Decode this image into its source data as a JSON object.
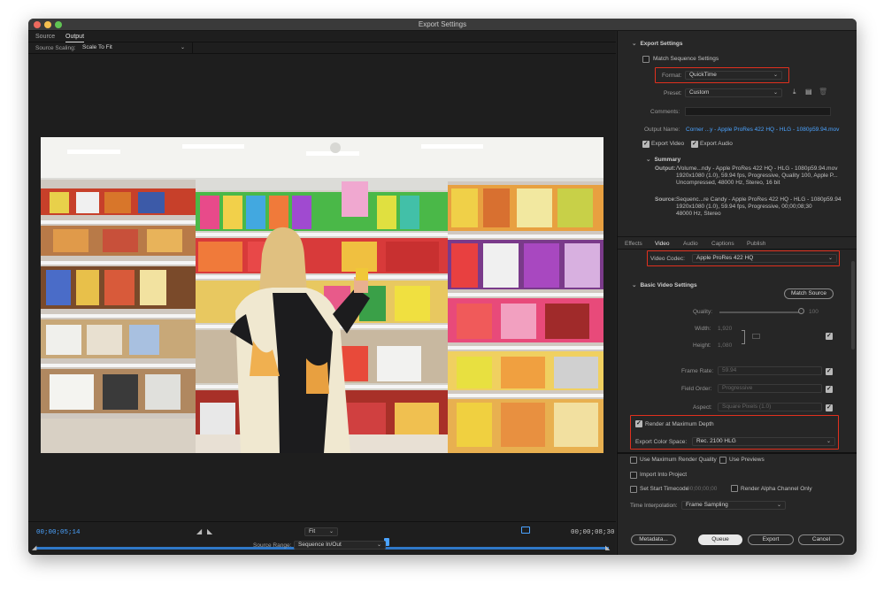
{
  "window": {
    "title": "Export Settings"
  },
  "left_tabs": [
    "Source",
    "Output"
  ],
  "source_scaling": {
    "label": "Source Scaling:",
    "value": "Scale To Fit"
  },
  "timeline": {
    "current_tc": "00;00;05;14",
    "end_tc": "00;00;08;30",
    "zoom": "Fit",
    "source_range_label": "Source Range:",
    "source_range_value": "Sequence In/Out"
  },
  "export_settings": {
    "heading": "Export Settings",
    "match_sequence": "Match Sequence Settings",
    "format_label": "Format:",
    "format_value": "QuickTime",
    "preset_label": "Preset:",
    "preset_value": "Custom",
    "comments_label": "Comments:",
    "output_name_label": "Output Name:",
    "output_name_value": "Corner ...y - Apple ProRes 422 HQ - HLG - 1080p59.94.mov",
    "export_video": "Export Video",
    "export_audio": "Export Audio"
  },
  "summary": {
    "heading": "Summary",
    "output_label": "Output:",
    "output_lines": [
      "/Volume...ndy - Apple ProRes 422 HQ - HLG - 1080p59.94.mov",
      "1920x1080 (1.0), 59.94 fps, Progressive, Quality 100, Apple P...",
      "Uncompressed, 48000 Hz, Stereo, 16 bit"
    ],
    "source_label": "Source:",
    "source_lines": [
      "Sequenc...re Candy - Apple ProRes 422 HQ - HLG - 1080p59.94",
      "1920x1080 (1.0), 59.94 fps, Progressive, 00;00;08;30",
      "48000 Hz, Stereo"
    ]
  },
  "right_tabs": [
    "Effects",
    "Video",
    "Audio",
    "Captions",
    "Publish"
  ],
  "video": {
    "codec_label": "Video Codec:",
    "codec_value": "Apple ProRes 422 HQ",
    "basic_heading": "Basic Video Settings",
    "match_source": "Match Source",
    "quality_label": "Quality:",
    "quality_value": "100",
    "width_label": "Width:",
    "width_value": "1,920",
    "height_label": "Height:",
    "height_value": "1,080",
    "frame_rate_label": "Frame Rate:",
    "frame_rate_value": "59.94",
    "field_order_label": "Field Order:",
    "field_order_value": "Progressive",
    "aspect_label": "Aspect:",
    "aspect_value": "Square Pixels (1.0)",
    "render_max_depth": "Render at Maximum Depth",
    "color_space_label": "Export Color Space:",
    "color_space_value": "Rec. 2100 HLG"
  },
  "bottom": {
    "max_render_quality": "Use Maximum Render Quality",
    "use_previews": "Use Previews",
    "import_project": "Import Into Project",
    "set_start_tc": "Set Start Timecode",
    "start_tc_value": "00;00;00;00",
    "render_alpha": "Render Alpha Channel Only",
    "time_interp_label": "Time Interpolation:",
    "time_interp_value": "Frame Sampling",
    "metadata": "Metadata...",
    "queue": "Queue",
    "export": "Export",
    "cancel": "Cancel"
  },
  "colors": {
    "accent_blue": "#4ba3ff",
    "highlight_red": "#e0301e"
  }
}
